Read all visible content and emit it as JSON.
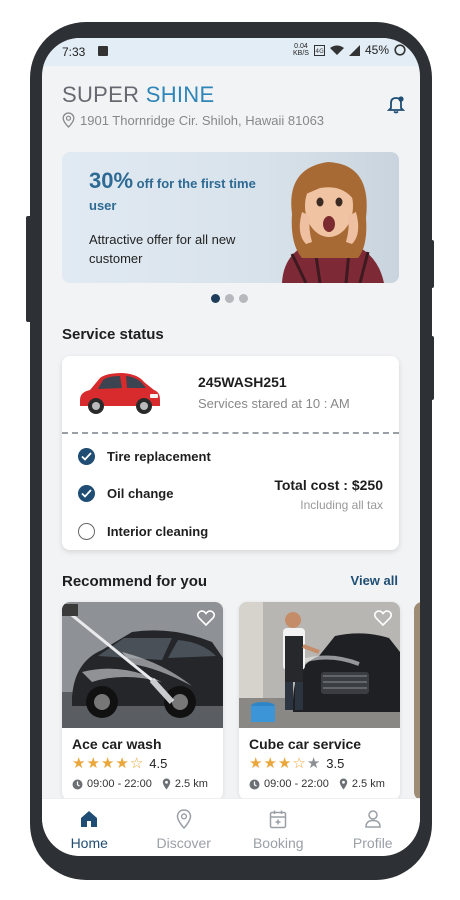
{
  "status_bar": {
    "time": "7:33",
    "network_speed": "0.04",
    "network_unit": "KB/S",
    "battery": "45%"
  },
  "header": {
    "brand_part1": "SUPER",
    "brand_part2": "SHINE",
    "address": "1901 Thornridge Cir. Shiloh, Hawaii 81063"
  },
  "banner": {
    "percent": "30%",
    "headline_rest": "off for the first time user",
    "subtext": "Attractive offer for all new customer"
  },
  "carousel": {
    "total": 3,
    "active": 1
  },
  "service_status": {
    "title": "Service status",
    "plate": "245WASH251",
    "started": "Services stared at 10 : AM",
    "tasks": [
      {
        "label": "Tire replacement",
        "done": true
      },
      {
        "label": "Oil change",
        "done": true
      },
      {
        "label": "Interior cleaning",
        "done": false
      }
    ],
    "total_cost": "Total cost : $250",
    "tax_note": "Including all tax"
  },
  "recommend": {
    "title": "Recommend for you",
    "view_all": "View all",
    "items": [
      {
        "name": "Ace car wash",
        "rating": "4.5",
        "hours": "09:00 - 22:00",
        "distance": "2.5 km"
      },
      {
        "name": "Cube car service",
        "rating": "3.5",
        "hours": "09:00 - 22:00",
        "distance": "2.5 km"
      }
    ]
  },
  "nav": {
    "items": [
      {
        "label": "Home",
        "icon": "home-icon",
        "active": true
      },
      {
        "label": "Discover",
        "icon": "location-pin-icon",
        "active": false
      },
      {
        "label": "Booking",
        "icon": "calendar-icon",
        "active": false
      },
      {
        "label": "Profile",
        "icon": "user-icon",
        "active": false
      }
    ]
  },
  "colors": {
    "accent": "#2e86b8",
    "primary": "#1f4d73",
    "star": "#e9a63a",
    "background": "#f2f3f5"
  }
}
